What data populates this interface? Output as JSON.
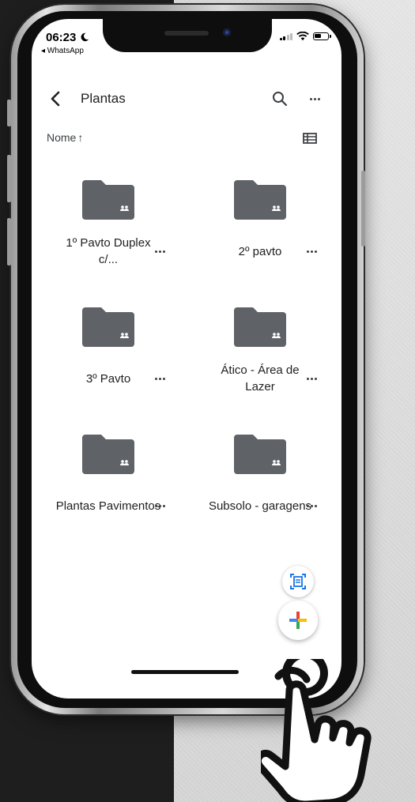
{
  "status_bar": {
    "time": "06:23",
    "back_app": "◂ WhatsApp"
  },
  "appbar": {
    "title": "Plantas"
  },
  "sort": {
    "label": "Nome",
    "arrow": "↑"
  },
  "folders": [
    {
      "name": "1º Pavto Duplex c/..."
    },
    {
      "name": "2º pavto"
    },
    {
      "name": "3º Pavto"
    },
    {
      "name": "Ático - Área de Lazer"
    },
    {
      "name": "Plantas Pavimentos"
    },
    {
      "name": "Subsolo - garagens"
    }
  ],
  "icons": {
    "back": "chevron-left",
    "search": "magnifier",
    "more": "three-dots",
    "view": "list-view",
    "folder": "shared-folder",
    "scan": "document-scanner",
    "new": "plus",
    "hand": "tap-hand"
  },
  "colors": {
    "folder": "#5f6368",
    "text": "#202124",
    "google_blue": "#4285F4",
    "google_red": "#EA4335",
    "google_yellow": "#FBBC04",
    "google_green": "#34A853",
    "scan_blue": "#1a73e8"
  }
}
